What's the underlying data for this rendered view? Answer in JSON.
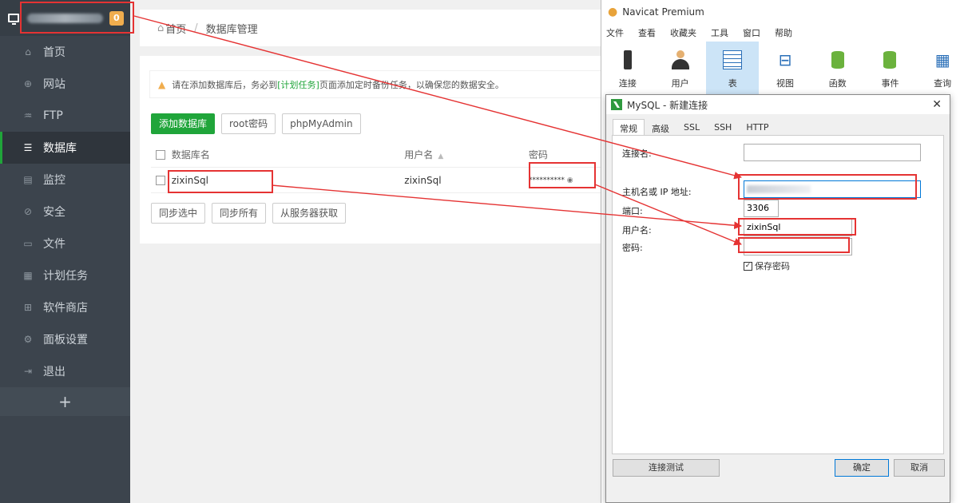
{
  "sidebar": {
    "badge": "0",
    "items": [
      {
        "label": "首页",
        "icon": "home-icon"
      },
      {
        "label": "网站",
        "icon": "globe-icon"
      },
      {
        "label": "FTP",
        "icon": "ftp-icon"
      },
      {
        "label": "数据库",
        "icon": "database-icon"
      },
      {
        "label": "监控",
        "icon": "monitor-icon"
      },
      {
        "label": "安全",
        "icon": "shield-icon"
      },
      {
        "label": "文件",
        "icon": "folder-icon"
      },
      {
        "label": "计划任务",
        "icon": "calendar-icon"
      },
      {
        "label": "软件商店",
        "icon": "grid-icon"
      },
      {
        "label": "面板设置",
        "icon": "gear-icon"
      },
      {
        "label": "退出",
        "icon": "logout-icon"
      }
    ],
    "add_label": "+"
  },
  "breadcrumb": {
    "home": "首页",
    "sep": "/",
    "current": "数据库管理"
  },
  "notice": {
    "prefix": "请在添加数据库后，务必到",
    "link": "[计划任务]",
    "suffix": "页面添加定时备份任务，以确保您的数据安全。"
  },
  "toolbar": {
    "add_db": "添加数据库",
    "root_pwd": "root密码",
    "phpmyadmin": "phpMyAdmin"
  },
  "table": {
    "headers": {
      "name": "数据库名",
      "user": "用户名",
      "pwd": "密码"
    },
    "rows": [
      {
        "name": "zixinSql",
        "user": "zixinSql",
        "pwd": "**********"
      }
    ]
  },
  "bottom_buttons": {
    "sync_selected": "同步选中",
    "sync_all": "同步所有",
    "fetch_server": "从服务器获取"
  },
  "navicat": {
    "title": "Navicat Premium",
    "menu": [
      "文件",
      "查看",
      "收藏夹",
      "工具",
      "窗口",
      "帮助"
    ],
    "tools": [
      "连接",
      "用户",
      "表",
      "视图",
      "函数",
      "事件",
      "查询"
    ],
    "dialog": {
      "title": "MySQL - 新建连接",
      "tabs": [
        "常规",
        "高级",
        "SSL",
        "SSH",
        "HTTP"
      ],
      "labels": {
        "conn_name": "连接名:",
        "host": "主机名或 IP 地址:",
        "port": "端口:",
        "user": "用户名:",
        "pwd": "密码:"
      },
      "values": {
        "conn_name": "",
        "port": "3306",
        "user": "zixinSql",
        "pwd": ""
      },
      "save_pwd": "保存密码",
      "buttons": {
        "test": "连接测试",
        "ok": "确定",
        "cancel": "取消"
      }
    }
  },
  "colors": {
    "annotation": "#e53333",
    "accent_green": "#20a53a",
    "sidebar_bg": "#3c444d"
  }
}
